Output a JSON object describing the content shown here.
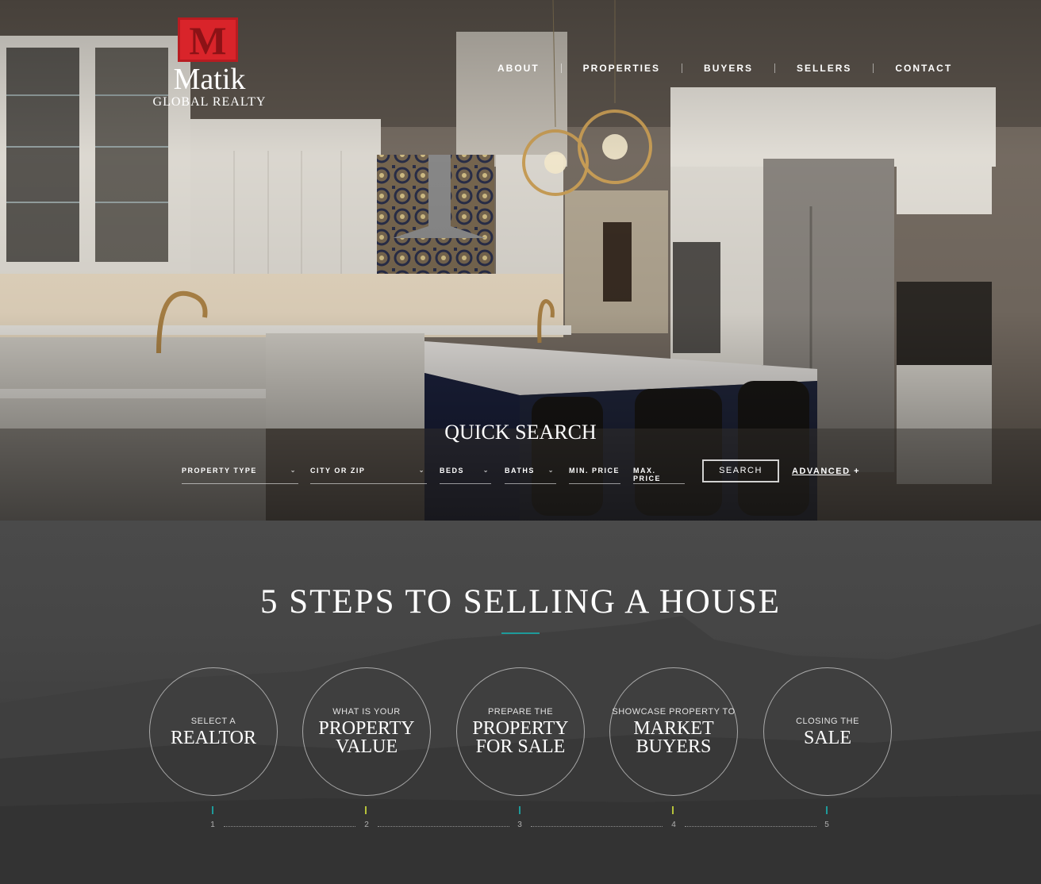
{
  "brand": {
    "logo_letter": "M",
    "name": "Matik",
    "tagline": "GLOBAL REALTY",
    "accent_color": "#d9242a"
  },
  "nav": {
    "items": [
      {
        "label": "ABOUT"
      },
      {
        "label": "PROPERTIES"
      },
      {
        "label": "BUYERS"
      },
      {
        "label": "SELLERS"
      },
      {
        "label": "CONTACT"
      }
    ]
  },
  "quick_search": {
    "title": "QUICK SEARCH",
    "fields": {
      "property_type": "PROPERTY TYPE",
      "city_zip": "CITY OR ZIP",
      "beds": "BEDS",
      "baths": "BATHS",
      "min_price": "MIN. PRICE",
      "max_price": "MAX. PRICE"
    },
    "search_label": "SEARCH",
    "advanced_label": "ADVANCED",
    "advanced_suffix": "+"
  },
  "steps": {
    "title": "5 STEPS TO SELLING A HOUSE",
    "rule_color": "#1e9a9a",
    "items": [
      {
        "small": "SELECT A",
        "big": "REALTOR",
        "number": "1",
        "tick_color": "#1e9a9a"
      },
      {
        "small": "WHAT IS YOUR",
        "big": "PROPERTY VALUE",
        "number": "2",
        "tick_color": "#b5c23a"
      },
      {
        "small": "PREPARE THE",
        "big": "PROPERTY FOR SALE",
        "number": "3",
        "tick_color": "#1e9a9a"
      },
      {
        "small": "SHOWCASE PROPERTY TO",
        "big": "MARKET BUYERS",
        "number": "4",
        "tick_color": "#b5c23a"
      },
      {
        "small": "CLOSING THE",
        "big": "SALE",
        "number": "5",
        "tick_color": "#1e9a9a"
      }
    ]
  }
}
